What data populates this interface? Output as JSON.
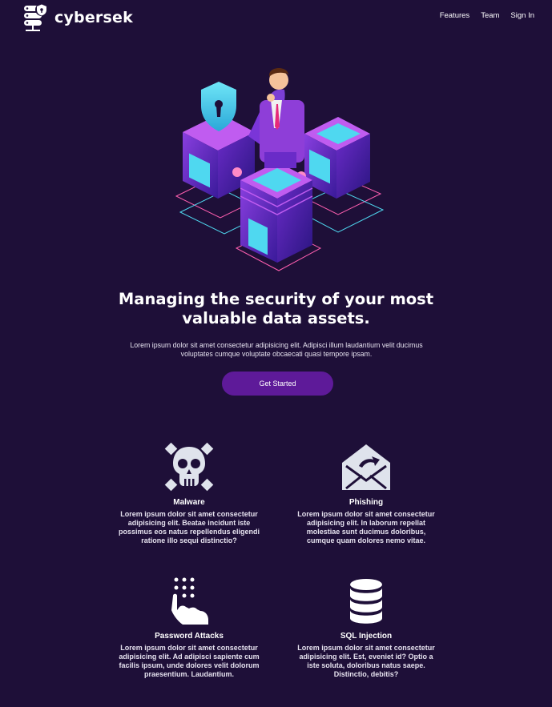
{
  "nav": {
    "brand": "cybersek",
    "links": [
      "Features",
      "Team",
      "Sign In"
    ]
  },
  "hero": {
    "title_line1": "Managing the security of your most",
    "title_line2": "valuable data assets.",
    "description": "Lorem ipsum dolor sit amet consectetur adipisicing elit. Adipisci illum laudantium velit ducimus voluptates cumque voluptate obcaecati quasi tempore ipsam.",
    "cta_label": "Get Started"
  },
  "features": [
    {
      "title": "Malware",
      "icon": "skull-crossbones-icon",
      "description": "Lorem ipsum dolor sit amet consectetur adipisicing elit. Beatae incidunt iste possimus eos natus repellendus eligendi ratione illo sequi distinctio?"
    },
    {
      "title": "Phishing",
      "icon": "envelope-hook-icon",
      "description": "Lorem ipsum dolor sit amet consectetur adipisicing elit. In laborum repellat molestiae sunt ducimus doloribus, cumque quam dolores nemo vitae."
    },
    {
      "title": "Password Attacks",
      "icon": "keypad-hand-icon",
      "description": "Lorem ipsum dolor sit amet consectetur adipisicing elit. Ad adipisci sapiente cum facilis ipsum, unde dolores velit dolorum praesentium. Laudantium."
    },
    {
      "title": "SQL Injection",
      "icon": "database-icon",
      "description": "Lorem ipsum dolor sit amet consectetur adipisicing elit. Est, eveniet id? Optio a iste soluta, doloribus natus saepe. Distinctio, debitis?"
    }
  ],
  "colors": {
    "background": "#1e0f38",
    "button": "#5e1a99",
    "accent_cyan": "#4fd8f0",
    "accent_purple": "#7a35d8"
  }
}
